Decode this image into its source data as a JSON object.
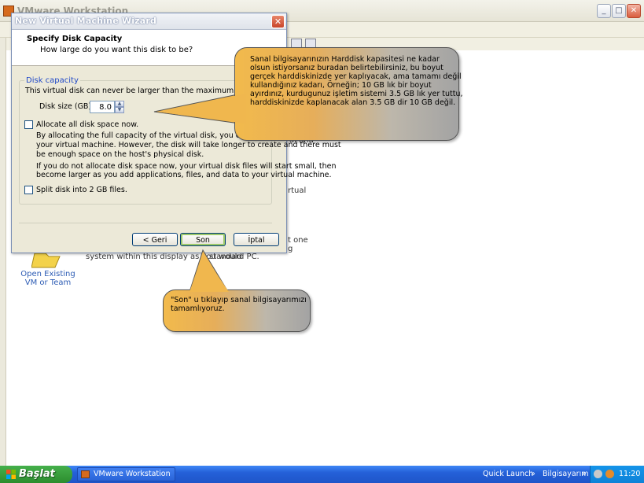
{
  "main_window": {
    "title": "VMware Workstation"
  },
  "background": {
    "open_existing_label": "Open Existing\nVM or Team",
    "fragments": [
      "al and",
      "rtual",
      "t one",
      "g",
      "system within this display as you would",
      "standard PC."
    ]
  },
  "wizard": {
    "title": "New Virtual Machine Wizard",
    "heading": "Specify Disk Capacity",
    "subheading": "How large do you want this disk to be?",
    "group_label": "Disk capacity",
    "max_text": "This virtual disk can never be larger than the maximum capacity that yo",
    "disk_size_label": "Disk size (GB):",
    "disk_size_value": "8.0",
    "allocate_label": "Allocate all disk space now.",
    "allocate_checked": false,
    "allocate_desc_1": "By allocating the full capacity of the virtual disk, you enhance perform",
    "allocate_desc_2": "your virtual machine.  However, the disk will take longer to create and there must",
    "allocate_desc_3": "be enough space on the host's physical disk.",
    "noalloc_desc_1": "If you do not allocate disk space now, your virtual disk files will start small, then",
    "noalloc_desc_2": "become larger as you add applications, files, and data to your virtual machine.",
    "split_label": "Split disk into 2 GB files.",
    "split_checked": false,
    "buttons": {
      "back": "< Geri",
      "next": "Son",
      "cancel": "İptal"
    }
  },
  "callouts": {
    "disk": [
      "Sanal bilgisayarınızın Harddisk kapasitesi ne kadar",
      "olsun istiyorsanız buradan belirtebilirsiniz, bu boyut",
      "gerçek harddiskinizde yer kaplıyacak, ama tamamı değil",
      "kullandığınız kadarı,  Örneğin; 10 GB lık bir boyut",
      "ayırdınız, kurdugunuz işletim sistemi 3.5 GB lık yer tuttu,",
      "harddiskinizde kaplanacak alan 3.5 GB dir 10 GB değil."
    ],
    "son": [
      "\"Son\" u tıklayıp sanal bilgisayarımızı",
      "tamamlıyoruz."
    ]
  },
  "taskbar": {
    "start_label": "Başlat",
    "task_label": "VMware Workstation",
    "quick_launch": "Quick Launch",
    "computer": "Bilgisayarım",
    "clock": "11:20"
  },
  "colors": {
    "taskbar_blue": "#2460d8",
    "start_green": "#2c8d2e",
    "callout_orange": "#f2ba4c",
    "group_label_blue": "#1f48c8"
  }
}
